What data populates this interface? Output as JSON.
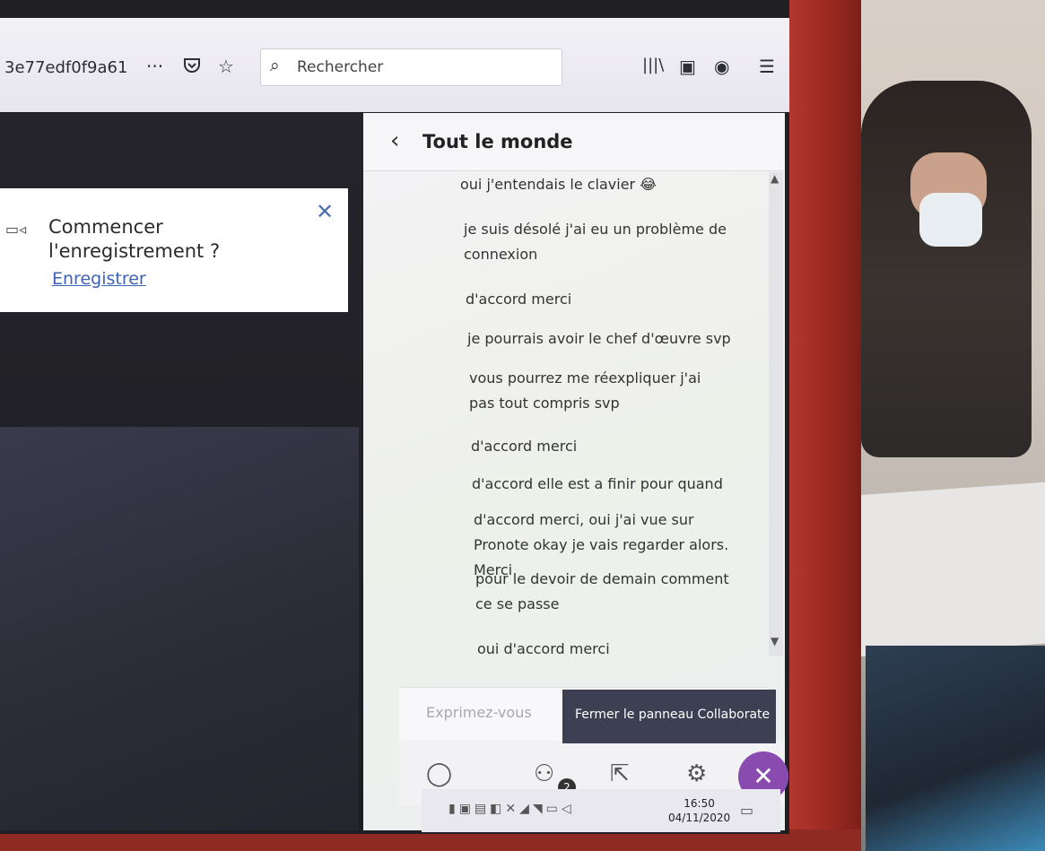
{
  "browser": {
    "url_fragment": "3e77edf0f9a61",
    "menu_dots": "···",
    "search_placeholder": "Rechercher"
  },
  "recording_prompt": {
    "title": "Commencer l'enregistrement ?",
    "link": "Enregistrer"
  },
  "chat": {
    "title": "Tout le monde",
    "messages": [
      "oui j'entendais le clavier 😂",
      "je suis désolé j'ai eu un problème de connexion",
      "d'accord merci",
      "je pourrais avoir le chef d'œuvre svp",
      "vous pourrez me réexpliquer j'ai pas tout compris svp",
      "d'accord merci",
      "d'accord elle est a finir pour quand",
      "d'accord merci, oui j'ai vue sur Pronote okay je vais regarder alors. Merci",
      "pour le devoir de demain comment ce se passe",
      "oui d'accord merci"
    ],
    "composer_placeholder": "Exprimez-vous",
    "tooltip": "Fermer le panneau Collaborate",
    "participants_count": "2"
  },
  "taskbar": {
    "time": "16:50",
    "date": "04/11/2020"
  }
}
